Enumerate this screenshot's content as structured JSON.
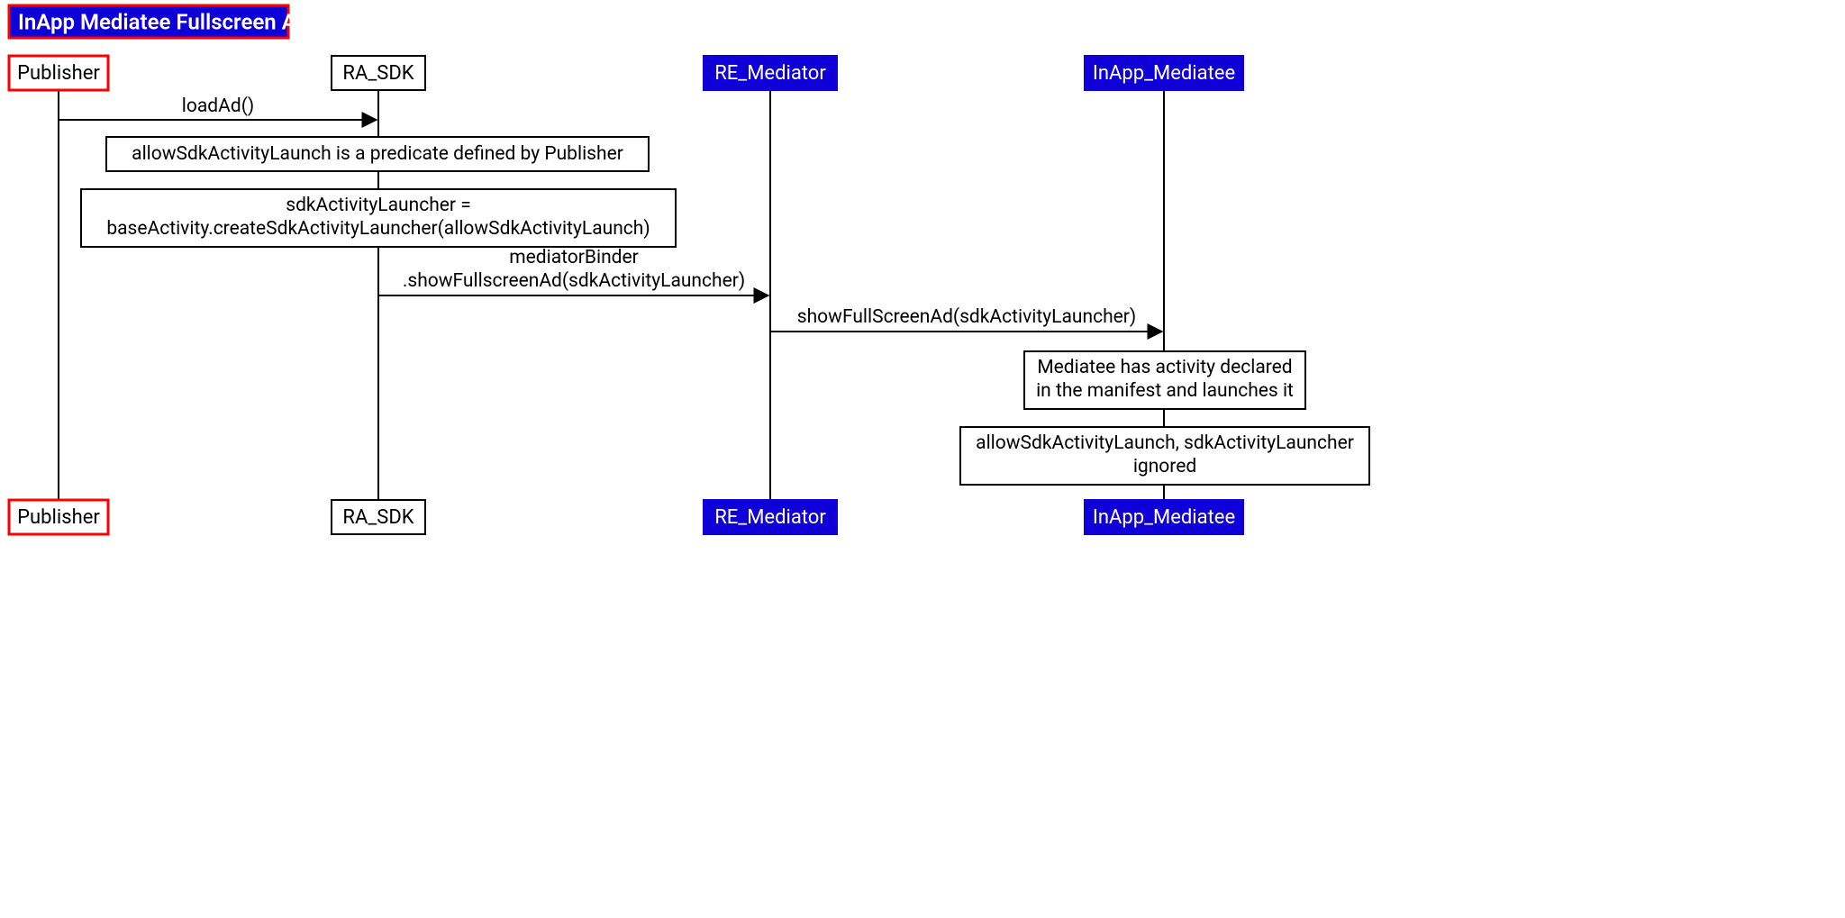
{
  "title": "InApp Mediatee Fullscreen Ad",
  "participants": {
    "publisher": "Publisher",
    "ra_sdk": "RA_SDK",
    "re_mediator": "RE_Mediator",
    "inapp_mediatee": "InApp_Mediatee"
  },
  "messages": {
    "loadAd": "loadAd()",
    "mediatorBinder_l1": "mediatorBinder",
    "mediatorBinder_l2": ".showFullscreenAd(sdkActivityLauncher)",
    "showFullScreenAd": "showFullScreenAd(sdkActivityLauncher)"
  },
  "notes": {
    "predicate": "allowSdkActivityLaunch is a predicate defined by Publisher",
    "launcher_l1": "sdkActivityLauncher =",
    "launcher_l2": "baseActivity.createSdkActivityLauncher(allowSdkActivityLaunch)",
    "manifest_l1": "Mediatee has activity declared",
    "manifest_l2": "in the manifest and launches it",
    "ignored_l1": "allowSdkActivityLaunch, sdkActivityLauncher",
    "ignored_l2": "ignored"
  }
}
